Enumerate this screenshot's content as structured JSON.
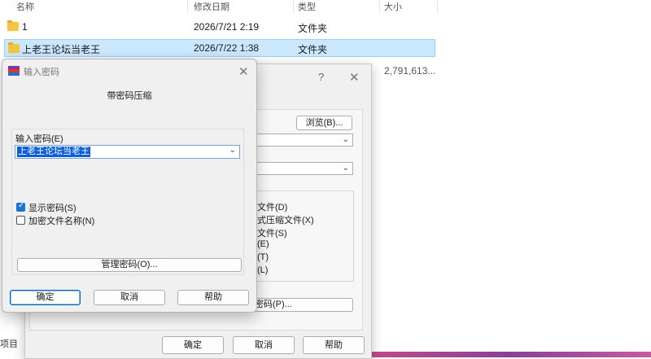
{
  "explorer": {
    "columns": [
      "名称",
      "修改日期",
      "类型",
      "大小"
    ],
    "rows": [
      {
        "name": "1",
        "date": "2026/7/21 2:19",
        "type": "文件夹",
        "size": ""
      },
      {
        "name": "上老王论坛当老王",
        "date": "2026/7/22 1:38",
        "type": "文件夹",
        "size": ""
      }
    ],
    "partial_row": {
      "size": "2,791,613..."
    },
    "bottom_left_fragment": "项目"
  },
  "archive_dialog": {
    "help_glyph": "?",
    "close_glyph": "✕",
    "browse_label": "浏览(B)...",
    "radio_fragments": [
      "文件(D)",
      "式压缩文件(X)",
      "文件(S)",
      "(E)",
      "(T)",
      "(L)"
    ],
    "set_password_fragment": "密码(P)...",
    "ok_label": "确定",
    "cancel_label": "取消",
    "help_label": "帮助"
  },
  "password_dialog": {
    "title": "输入密码",
    "close_glyph": "✕",
    "heading": "带密码压缩",
    "field_label": "输入密码(E)",
    "password_value": "上老王论坛当老王",
    "show_password_label": "显示密码(S)",
    "show_password_checked": true,
    "encrypt_names_label": "加密文件名称(N)",
    "encrypt_names_checked": false,
    "manage_label": "管理密码(O)...",
    "ok_label": "确定",
    "cancel_label": "取消",
    "help_label": "帮助"
  },
  "colors": {
    "selection": "#cce8ff",
    "accent": "#0067c0",
    "folder": "#f5c542"
  }
}
